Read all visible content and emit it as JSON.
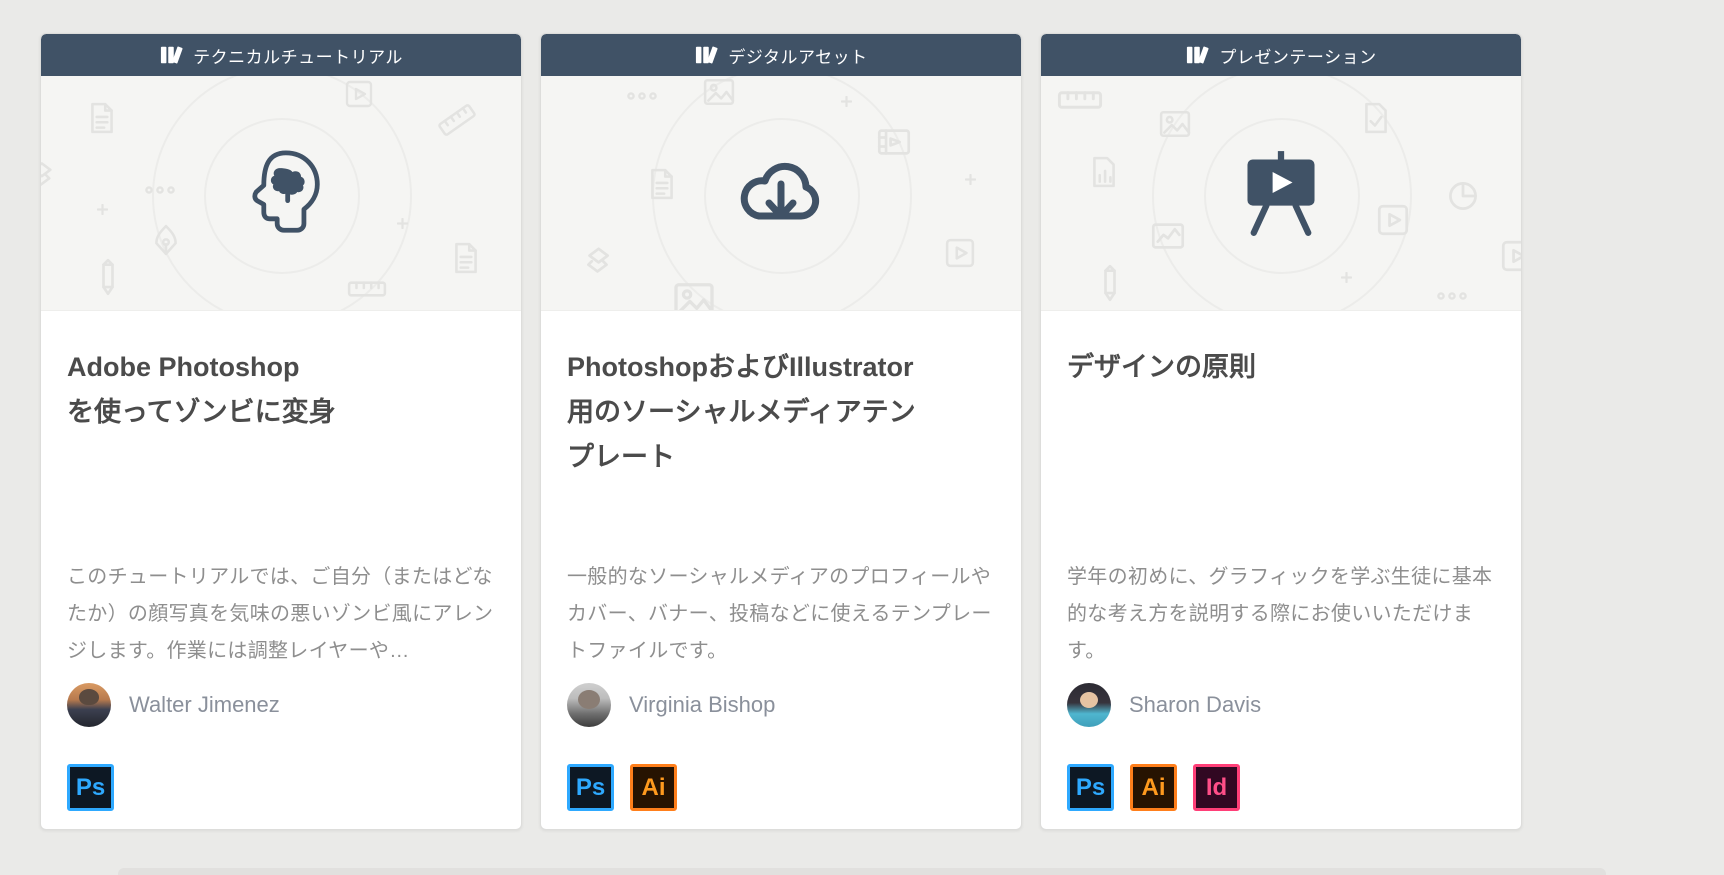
{
  "page": {
    "background_color": "#eaeae8"
  },
  "colors": {
    "category_bar": "#405266",
    "hero_icon": "#405266",
    "card_background": "#ffffff",
    "hero_background": "#f5f5f3",
    "title_text": "#4b4b4b",
    "description_text": "#8e8e8e",
    "author_text": "#8a909b",
    "badge_ps": {
      "bg": "#0d1824",
      "border": "#2ea9ff",
      "text": "#2ea9ff"
    },
    "badge_ai": {
      "bg": "#271301",
      "border": "#ff7f1b",
      "text": "#ff9a1e"
    },
    "badge_id": {
      "bg": "#310822",
      "border": "#ff3f78",
      "text": "#ff4e88"
    }
  },
  "icons": {
    "category_icon": "books-icon",
    "hero_icons": [
      "brain-head-icon",
      "cloud-download-icon",
      "presentation-easel-icon"
    ],
    "hero_decorations": [
      "document-icon",
      "image-icon",
      "play-document-icon",
      "ellipsis-icon",
      "pen-nib-icon",
      "pencil-icon",
      "ruler-icon",
      "film-icon",
      "layers-icon",
      "pie-chart-icon",
      "bar-chart-icon",
      "line-chart-icon",
      "sparkle-icon"
    ]
  },
  "cards": [
    {
      "category": "テクニカルチュートリアル",
      "title": "Adobe Photoshop\nを使ってゾンビに変身",
      "description": "このチュートリアルでは、ご自分（またはどなたか）の顔写真を気味の悪いゾンビ風にアレンジします。作業には調整レイヤーや…",
      "author": "Walter Jimenez",
      "badges": [
        {
          "label": "Ps"
        }
      ]
    },
    {
      "category": "デジタルアセット",
      "title": "PhotoshopおよびIllustrator\n用のソーシャルメディアテン\nプレート",
      "description": "一般的なソーシャルメディアのプロフィールやカバー、バナー、投稿などに使えるテンプレートファイルです。",
      "author": "Virginia Bishop",
      "badges": [
        {
          "label": "Ps"
        },
        {
          "label": "Ai"
        }
      ]
    },
    {
      "category": "プレゼンテーション",
      "title": "デザインの原則",
      "description": "学年の初めに、グラフィックを学ぶ生徒に基本的な考え方を説明する際にお使いいただけます。",
      "author": "Sharon Davis",
      "badges": [
        {
          "label": "Ps"
        },
        {
          "label": "Ai"
        },
        {
          "label": "Id"
        }
      ]
    }
  ]
}
